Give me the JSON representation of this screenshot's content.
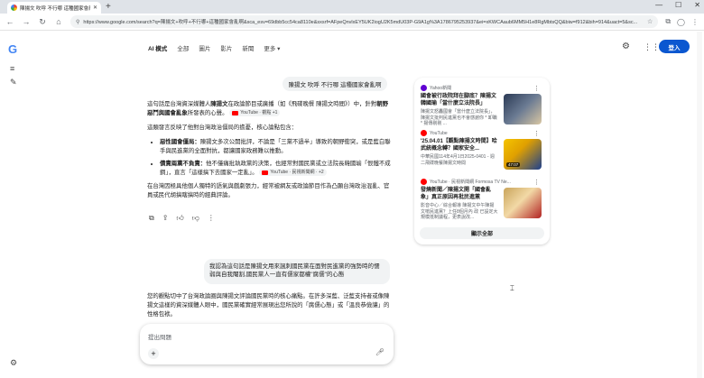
{
  "browser": {
    "tab_title": "陳揚文 吹呼 不行哪 這種國家會亂...",
    "url": "https://www.google.com/search?q=陳揚文+吹呼+不行哪+這種國家會亂啊&sca_esv=69dbb5cc54ca8110e&sxsrf=AFpeQnvlxEY5UK2iogU2K5mdU03P-G9A1g%3A1786795253937&ei=xKWCAaub6MM5H1e8RgMbtsQQ&biw=f912&bih=914&uact=5&sc..."
  },
  "header": {
    "modes": [
      "AI 模式",
      "全部",
      "圖片",
      "影片",
      "新聞",
      "更多 ▾"
    ],
    "login_label": "登入"
  },
  "chat": {
    "question1": "陳揚文 吹呼 不行哪 這種國家會亂啊",
    "p1_a": "這句話是台灣資深媒體人",
    "p1_b": "陳揚文",
    "p1_c": "在政論節目或廣播（如《飛碟晚餐 陳揚文時間》）中，針對",
    "p1_d": "朝野惡鬥與國會亂象",
    "p1_e": "所發表的心聲。",
    "chip1": "YouTube · 觀點 +1",
    "p2": "這類發言反映了他對台灣政治僵局的擔憂，核心論點包含：",
    "b1_title": "惡性國會僵局：",
    "b1_text": "陳揚文多次公開批評，不論是「三黨不過半」導致的朝野衝突，或是藍白聯手與民進黨的全面對抗，都讓國家政務難以推動。",
    "b2_title": "債責兩黨不負責：",
    "b2_text": "他不僅痛批執政黨的決策，也經常對國民黨或立法院長韓國瑜「恨鐵不成鋼」，直言「這樣搞下去國家一定亂」。",
    "chip2": "YouTube · 民視新聞網 · +2",
    "p3": "在台灣因極具他個人獨特的語氣與戲劇張力，經常被網友或政論節目作為凸顯台灣政治混亂、官員或民代胡搞瞎搞時的經典評論。",
    "question2": "我認為這句話是陳揚文用來諷刺國民黨在面對民進黨的強勢時的懦弱與自我閹割,國民黨人一直有儒家都權\"腐儒\"的心態",
    "p4": "您的觀點切中了台灣政論圈與陳揚文評論國民黨時的核心痛點。在許多深藍、泛藍支持者或像陳揚文這樣的資深媒體人眼中，國民黨確實經常展現出您所說的「腐儒心態」或「溫良恭儉讓」的性格包袱。"
  },
  "input": {
    "placeholder": "提出問題"
  },
  "sources": {
    "items": [
      {
        "publisher": "Yahoo新聞",
        "title": "國會被行政院拜在腳底？陳揚文韓國瑜「當什麼立法院長」",
        "snippet": "陳揚文怒轟國會「當什麼立法院長」，陳揚文批判民進黨也不會感謝你 * 卸職 * 揚傳剔剔 ...",
        "badge_color": "#6001d2"
      },
      {
        "publisher": "YouTube",
        "title": "'25.04.01【觀點陳揚文時間】哈武統概念轉？國家安全...",
        "snippet": "中華民國114年4月1日2025-0401 - 週二飛碟晚餐陳揚文時間",
        "badge_color": "#ff0000",
        "duration": "47:07"
      },
      {
        "publisher": "YouTube · 民視新聞網 Formosa TV Ne...",
        "title": "發燒新聞／陳揚文開「國會亂象」真正原因再批民進黨",
        "snippet": "影音中心／綜合報導 陳揚文中午陳揚文嗆民進黨？上任8個月內 政 已設定大規模抵制議程，更表說改...",
        "badge_color": "#ff0000"
      }
    ],
    "show_all": "顯示全部"
  },
  "colors": {
    "accent": "#0b57d0",
    "bubble": "#f1f3f4"
  }
}
